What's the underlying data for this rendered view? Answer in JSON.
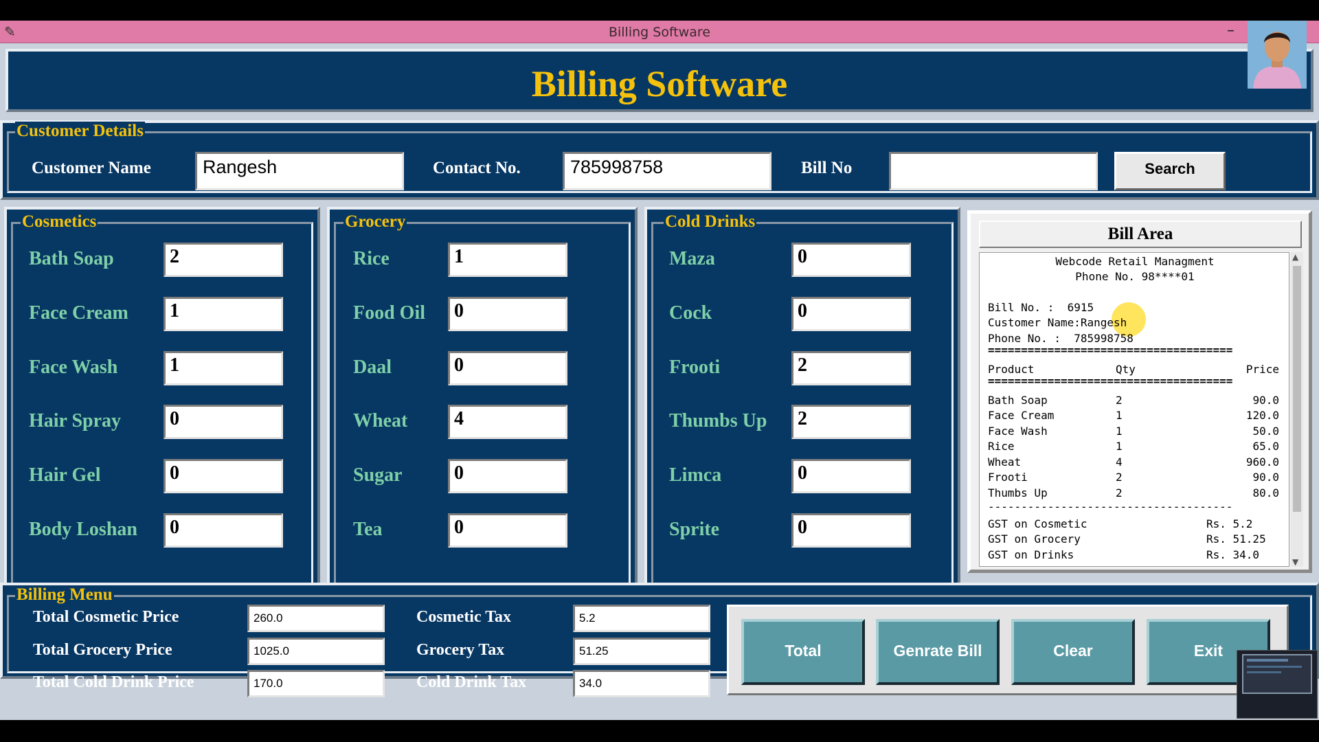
{
  "window": {
    "title": "Billing Software"
  },
  "header": {
    "title": "Billing Software"
  },
  "customer": {
    "legend": "Customer Details",
    "name_label": "Customer Name",
    "name_value": "Rangesh",
    "contact_label": "Contact No.",
    "contact_value": "785998758",
    "bill_label": "Bill No",
    "bill_value": "",
    "search_label": "Search"
  },
  "cosmetics": {
    "legend": "Cosmetics",
    "items": [
      {
        "label": "Bath Soap",
        "qty": "2"
      },
      {
        "label": "Face Cream",
        "qty": "1"
      },
      {
        "label": "Face Wash",
        "qty": "1"
      },
      {
        "label": "Hair Spray",
        "qty": "0"
      },
      {
        "label": "Hair Gel",
        "qty": "0"
      },
      {
        "label": "Body Loshan",
        "qty": "0"
      }
    ]
  },
  "grocery": {
    "legend": "Grocery",
    "items": [
      {
        "label": "Rice",
        "qty": "1"
      },
      {
        "label": "Food Oil",
        "qty": "0"
      },
      {
        "label": "Daal",
        "qty": "0"
      },
      {
        "label": "Wheat",
        "qty": "4"
      },
      {
        "label": "Sugar",
        "qty": "0"
      },
      {
        "label": "Tea",
        "qty": "0"
      }
    ]
  },
  "drinks": {
    "legend": "Cold Drinks",
    "items": [
      {
        "label": "Maza",
        "qty": "0"
      },
      {
        "label": "Cock",
        "qty": "0"
      },
      {
        "label": "Frooti",
        "qty": "2"
      },
      {
        "label": "Thumbs Up",
        "qty": "2"
      },
      {
        "label": "Limca",
        "qty": "0"
      },
      {
        "label": "Sprite",
        "qty": "0"
      }
    ]
  },
  "bill": {
    "title": "Bill Area",
    "shop": "Webcode Retail Managment",
    "phone": "Phone No. 98****01",
    "bill_no": "Bill No. :  6915",
    "customer_name": "Customer Name:Rangesh",
    "phone_no": "Phone No. :  785998758",
    "separator_double": "=====================================",
    "separator_single": "-------------------------------------",
    "columns": {
      "product": "Product",
      "qty": "Qty",
      "price": "Price"
    },
    "rows": [
      {
        "product": "Bath Soap",
        "qty": "2",
        "price": "90.0"
      },
      {
        "product": "Face Cream",
        "qty": "1",
        "price": "120.0"
      },
      {
        "product": "Face Wash",
        "qty": "1",
        "price": "50.0"
      },
      {
        "product": "Rice",
        "qty": "1",
        "price": "65.0"
      },
      {
        "product": "Wheat",
        "qty": "4",
        "price": "960.0"
      },
      {
        "product": "Frooti",
        "qty": "2",
        "price": "90.0"
      },
      {
        "product": "Thumbs Up",
        "qty": "2",
        "price": "80.0"
      }
    ],
    "gst": [
      {
        "label": "GST on Cosmetic",
        "value": "Rs. 5.2"
      },
      {
        "label": "GST on Grocery",
        "value": "Rs. 51.25"
      },
      {
        "label": "GST on Drinks",
        "value": "Rs. 34.0"
      }
    ]
  },
  "billing_menu": {
    "legend": "Billing Menu",
    "total_cosmetic_label": "Total Cosmetic Price",
    "total_cosmetic_value": "260.0",
    "total_grocery_label": "Total Grocery Price",
    "total_grocery_value": "1025.0",
    "total_drink_label": "Total Cold Drink Price",
    "total_drink_value": "170.0",
    "cosmetic_tax_label": "Cosmetic Tax",
    "cosmetic_tax_value": "5.2",
    "grocery_tax_label": "Grocery Tax",
    "grocery_tax_value": "51.25",
    "drink_tax_label": "Cold Drink Tax",
    "drink_tax_value": "34.0"
  },
  "buttons": {
    "total": "Total",
    "generate": "Genrate Bill",
    "clear": "Clear",
    "exit": "Exit"
  },
  "colors": {
    "panel_bg": "#073763",
    "legend_gold": "#f4c20d",
    "item_green": "#7fd0a8",
    "titlebar_pink": "#e07aa6",
    "button_teal": "#5a9aa5"
  },
  "icons": {
    "titlebar": "feather-icon",
    "minimize": "minimize-icon",
    "avatar": "presenter-avatar",
    "logo": "webcode-logo"
  }
}
